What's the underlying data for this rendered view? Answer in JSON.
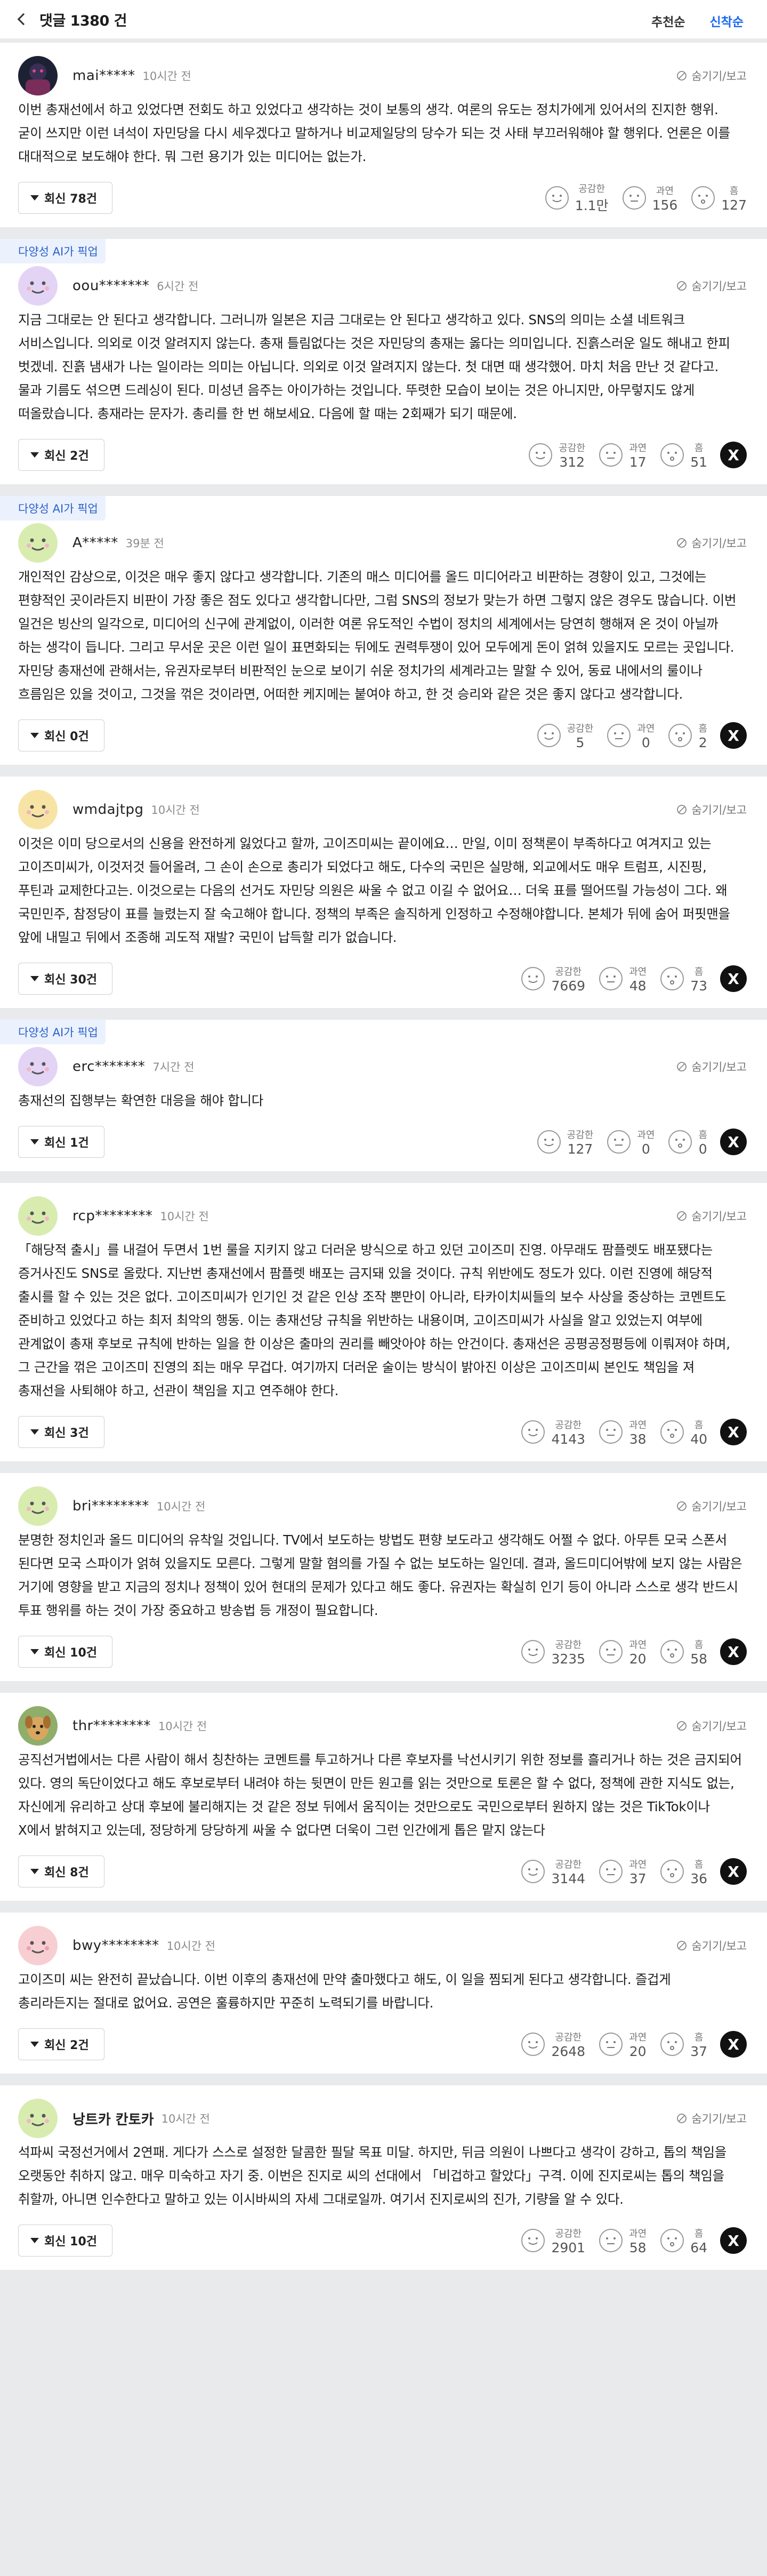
{
  "header": {
    "title": "댓글 1380 건",
    "sorts": [
      {
        "label": "추천순",
        "active": false
      },
      {
        "label": "신착순",
        "active": true
      }
    ]
  },
  "labels": {
    "ai_pick": "다양성 AI가 픽업",
    "hide": "숨기기/보고",
    "react_empathy": "공감한",
    "react_thought": "과연",
    "react_hmm": "흠",
    "x_share": "X"
  },
  "colors": {
    "accent": "#1a67f5",
    "ai_pick_bg": "#ebf1fd",
    "ai_pick_text": "#2b62c9"
  },
  "comments": [
    {
      "ai_pick": false,
      "avatar": "photo-avatar-dark",
      "nickname": "mai*****",
      "time": "10시간 전",
      "text": "이번 총재선에서 하고 있었다면 전회도 하고 있었다고 생각하는 것이 보통의 생각. 여론의 유도는 정치가에게 있어서의 진지한 행위. 굳이 쓰지만 이런 녀석이 자민당을 다시 세우겠다고 말하거나 비교제일당의 당수가 되는 것 사태 부끄러워해야 할 행위다. 언론은 이를 대대적으로 보도해야 한다. 뭐 그런 용기가 있는 미디어는 없는가.",
      "replies": "회신 78건",
      "empathy": "1.1만",
      "thought": "156",
      "hmm": "127",
      "x": false
    },
    {
      "ai_pick": true,
      "avatar": "default-avatar-lavender",
      "nickname": "oou*******",
      "time": "6시간 전",
      "text": "지금 그대로는 안 된다고 생각합니다. 그러니까 일본은 지금 그대로는 안 된다고 생각하고 있다. SNS의 의미는 소셜 네트워크 서비스입니다. 의외로 이것 알려지지 않는다. 총재 틀림없다는 것은 자민당의 총재는 옳다는 의미입니다. 진흙스러운 일도 해내고 한피 벗겠네. 진흙 냄새가 나는 일이라는 의미는 아닙니다. 의외로 이것 알려지지 않는다. 첫 대면 때 생각했어. 마치 처음 만난 것 같다고. 물과 기름도 섞으면 드레싱이 된다. 미성년 음주는 아이가하는 것입니다. 뚜렷한 모습이 보이는 것은 아니지만, 아무렇지도 않게 떠올랐습니다. 총재라는 문자가. 총리를 한 번 해보세요. 다음에 할 때는 2회째가 되기 때문에.",
      "replies": "회신 2건",
      "empathy": "312",
      "thought": "17",
      "hmm": "51",
      "x": true
    },
    {
      "ai_pick": true,
      "avatar": "default-avatar-green",
      "nickname": "A*****",
      "time": "39분 전",
      "text": "개인적인 감상으로, 이것은 매우 좋지 않다고 생각합니다. 기존의 매스 미디어를 올드 미디어라고 비판하는 경향이 있고, 그것에는 편향적인 곳이라든지 비판이 가장 좋은 점도 있다고 생각합니다만, 그럼 SNS의 정보가 맞는가 하면 그렇지 않은 경우도 많습니다. 이번 일건은 빙산의 일각으로, 미디어의 신구에 관계없이, 이러한 여론 유도적인 수법이 정치의 세계에서는 당연히 행해져 온 것이 아닐까 하는 생각이 듭니다. 그리고 무서운 곳은 이런 일이 표면화되는 뒤에도 권력투쟁이 있어 모두에게 돈이 얽혀 있을지도 모르는 곳입니다. 자민당 총재선에 관해서는, 유권자로부터 비판적인 눈으로 보이기 쉬운 정치가의 세계라고는 말할 수 있어, 동료 내에서의 룰이나 흐름임은 있을 것이고, 그것을 꺾은 것이라면, 어떠한 케지메는 붙여야 하고, 한 것 승리와 같은 것은 좋지 않다고 생각합니다.",
      "replies": "회신 0건",
      "empathy": "5",
      "thought": "0",
      "hmm": "2",
      "x": true
    },
    {
      "ai_pick": false,
      "avatar": "default-avatar-yellow",
      "nickname": "wmdajtpg",
      "time": "10시간 전",
      "text": "이것은 이미 당으로서의 신용을 완전하게 잃었다고 할까, 고이즈미씨는 끝이에요… 만일, 이미 정책론이 부족하다고 여겨지고 있는 고이즈미씨가, 이것저것 들어올려, 그 손이 손으로 총리가 되었다고 해도, 다수의 국민은 실망해, 외교에서도 매우 트럼프, 시진핑, 푸틴과 교제한다고는. 이것으로는 다음의 선거도 자민당 의원은 싸울 수 없고 이길 수 없어요… 더욱 표를 떨어뜨릴 가능성이 그다. 왜 국민민주, 참정당이 표를 늘렸는지 잘 숙고해야 합니다. 정책의 부족은 솔직하게 인정하고 수정해야합니다. 본체가 뒤에 숨어 퍼핏맨을 앞에 내밀고 뒤에서 조종해 괴도적 재발? 국민이 납득할 리가 없습니다.",
      "replies": "회신 30건",
      "empathy": "7669",
      "thought": "48",
      "hmm": "73",
      "x": true
    },
    {
      "ai_pick": true,
      "avatar": "default-avatar-lavender",
      "nickname": "erc*******",
      "time": "7시간 전",
      "text": "총재선의 집행부는 확연한 대응을 해야 합니다",
      "replies": "회신 1건",
      "empathy": "127",
      "thought": "0",
      "hmm": "0",
      "x": true
    },
    {
      "ai_pick": false,
      "avatar": "default-avatar-green",
      "nickname": "rcp********",
      "time": "10시간 전",
      "text": "「해당적 출시」를 내걸어 두면서 1번 룰을 지키지 않고 더러운 방식으로 하고 있던 고이즈미 진영. 아무래도 팜플렛도 배포됐다는 증거사진도 SNS로 올랐다. 지난번 총재선에서 팜플렛 배포는 금지돼 있을 것이다. 규칙 위반에도 정도가 있다. 이런 진영에 해당적 출시를 할 수 있는 것은 없다. 고이즈미씨가 인기인 것 같은 인상 조작 뿐만이 아니라, 타카이치씨들의 보수 사상을 중상하는 코멘트도 준비하고 있었다고 하는 최저 최악의 행동. 이는 총재선당 규칙을 위반하는 내용이며, 고이즈미씨가 사실을 알고 있었는지 여부에 관계없이 총재 후보로 규칙에 반하는 일을 한 이상은 출마의 권리를 빼앗아야 하는 안건이다. 총재선은 공평공정평등에 이뤄져야 하며, 그 근간을 꺾은 고이즈미 진영의 죄는 매우 무겁다. 여기까지 더러운 술이는 방식이 밝아진 이상은 고이즈미씨 본인도 책임을 져 총재선을 사퇴해야 하고, 선관이 책임을 지고 연주해야 한다.",
      "replies": "회신 3건",
      "empathy": "4143",
      "thought": "38",
      "hmm": "40",
      "x": true
    },
    {
      "ai_pick": false,
      "avatar": "default-avatar-green",
      "nickname": "bri********",
      "time": "10시간 전",
      "text": "분명한 정치인과 올드 미디어의 유착일 것입니다. TV에서 보도하는 방법도 편향 보도라고 생각해도 어쩔 수 없다. 아무튼 모국 스폰서 된다면 모국 스파이가 얽혀 있을지도 모른다. 그렇게 말할 혐의를 가질 수 없는 보도하는 일인데. 결과, 올드미디어밖에 보지 않는 사람은 거기에 영향을 받고 지금의 정치나 정책이 있어 현대의 문제가 있다고 해도 좋다. 유권자는 확실히 인기 등이 아니라 스스로 생각 반드시 투표 행위를 하는 것이 가장 중요하고 방송법 등 개정이 필요합니다.",
      "replies": "회신 10건",
      "empathy": "3235",
      "thought": "20",
      "hmm": "58",
      "x": true
    },
    {
      "ai_pick": false,
      "avatar": "photo-avatar-dog",
      "nickname": "thr********",
      "time": "10시간 전",
      "text": "공직선거법에서는 다른 사람이 해서 칭찬하는 코멘트를 투고하거나 다른 후보자를 낙선시키기 위한 정보를 흘리거나 하는 것은 금지되어 있다. 영의 독단이었다고 해도 후보로부터 내려야 하는 뒷면이 만든 원고를 읽는 것만으로 토론은 할 수 없다, 정책에 관한 지식도 없는, 자신에게 유리하고 상대 후보에 불리해지는 것 같은 정보 뒤에서 움직이는 것만으로도 국민으로부터 원하지 않는 것은 TikTok이나 X에서 밝혀지고 있는데, 정당하게 당당하게 싸울 수 없다면 더욱이 그런 인간에게 톱은 맡지 않는다",
      "replies": "회신 8건",
      "empathy": "3144",
      "thought": "37",
      "hmm": "36",
      "x": true
    },
    {
      "ai_pick": false,
      "avatar": "default-avatar-pink",
      "nickname": "bwy********",
      "time": "10시간 전",
      "text": "고이즈미 씨는 완전히 끝났습니다. 이번 이후의 총재선에 만약 출마했다고 해도, 이 일을 찜되게 된다고 생각합니다. 즐겁게 총리라든지는 절대로 없어요. 공연은 훌륭하지만 꾸준히 노력되기를 바랍니다.",
      "replies": "회신 2건",
      "empathy": "2648",
      "thought": "20",
      "hmm": "37",
      "x": true
    },
    {
      "ai_pick": false,
      "avatar": "default-avatar-green",
      "nickname": "낭트카 칸토카",
      "nickname_bold": true,
      "time": "10시간 전",
      "text": "석파씨 국정선거에서 2연패. 게다가 스스로 설정한 달콤한 필달 목표 미달. 하지만, 뒤금 의원이 나쁘다고 생각이 강하고, 톱의 책임을 오랫동안 취하지 않고. 매우 미숙하고 자기 중. 이번은 진지로 씨의 선대에서 「비겁하고 할았다」구격. 이에 진지로씨는 톱의 책임을 취할까, 아니면 인수한다고 말하고 있는 이시바씨의 자세 그대로일까. 여기서 진지로씨의 진가, 기량을 알 수 있다.",
      "replies": "회신 10건",
      "empathy": "2901",
      "thought": "58",
      "hmm": "64",
      "x": true
    }
  ]
}
